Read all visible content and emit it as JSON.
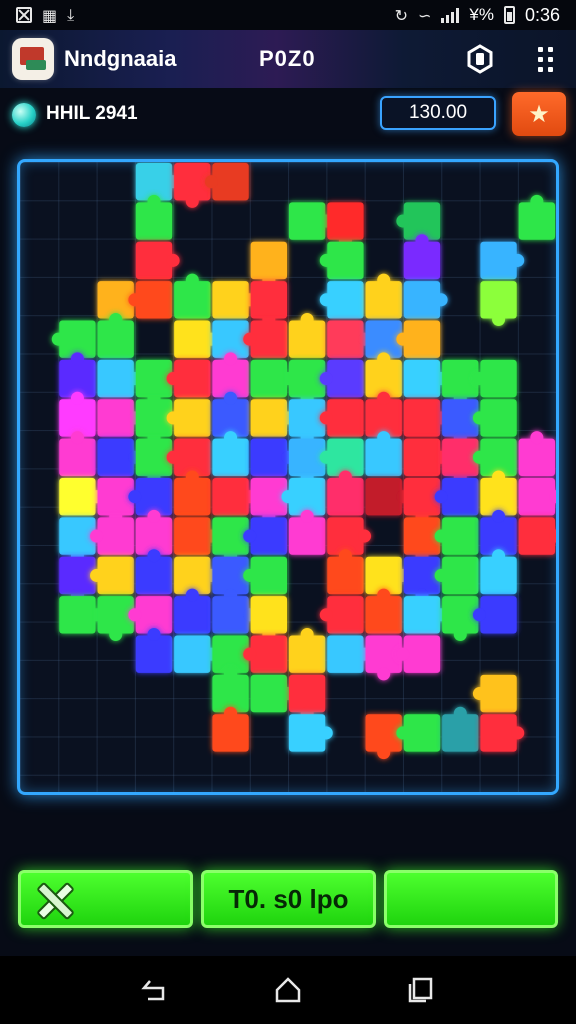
{
  "status_bar": {
    "time": "0:36",
    "percent_text": "¥%",
    "icons": [
      "close-box-icon",
      "image-icon",
      "download-icon",
      "sync-icon",
      "wifi-icon",
      "signal-icon",
      "battery-icon"
    ]
  },
  "header": {
    "title": "Nndgnaaia",
    "subtitle": "P0Z0",
    "icons": [
      "app-icon",
      "hexagon-icon",
      "grid-menu-icon"
    ]
  },
  "info": {
    "level_label": "HHIL 2941",
    "score": "130.00",
    "star": "★"
  },
  "board": {
    "cols": 14,
    "rows": 16,
    "tiles": [
      {
        "c": 3,
        "r": 0,
        "color": "#39d0e8"
      },
      {
        "c": 4,
        "r": 0,
        "color": "#ff2e3c"
      },
      {
        "c": 5,
        "r": 0,
        "color": "#e83a22"
      },
      {
        "c": 3,
        "r": 1,
        "color": "#2ee64a"
      },
      {
        "c": 7,
        "r": 1,
        "color": "#2ee64a"
      },
      {
        "c": 8,
        "r": 1,
        "color": "#ff2b2b"
      },
      {
        "c": 10,
        "r": 1,
        "color": "#22c55a"
      },
      {
        "c": 13,
        "r": 1,
        "color": "#2ee64a"
      },
      {
        "c": 3,
        "r": 2,
        "color": "#ff2e3c"
      },
      {
        "c": 6,
        "r": 2,
        "color": "#ffb21e"
      },
      {
        "c": 8,
        "r": 2,
        "color": "#2ee64a"
      },
      {
        "c": 10,
        "r": 2,
        "color": "#7a2cff"
      },
      {
        "c": 12,
        "r": 2,
        "color": "#39b4ff"
      },
      {
        "c": 2,
        "r": 3,
        "color": "#ffb21e"
      },
      {
        "c": 3,
        "r": 3,
        "color": "#ff4a1e"
      },
      {
        "c": 4,
        "r": 3,
        "color": "#2ee64a"
      },
      {
        "c": 5,
        "r": 3,
        "color": "#ffd21e"
      },
      {
        "c": 6,
        "r": 3,
        "color": "#ff2e3c"
      },
      {
        "c": 8,
        "r": 3,
        "color": "#39d0ff"
      },
      {
        "c": 9,
        "r": 3,
        "color": "#ffd21e"
      },
      {
        "c": 10,
        "r": 3,
        "color": "#39b4ff"
      },
      {
        "c": 12,
        "r": 3,
        "color": "#8cff3a"
      },
      {
        "c": 1,
        "r": 4,
        "color": "#2ee64a"
      },
      {
        "c": 2,
        "r": 4,
        "color": "#2ee64a"
      },
      {
        "c": 4,
        "r": 4,
        "color": "#ffe21e"
      },
      {
        "c": 5,
        "r": 4,
        "color": "#39c8ff"
      },
      {
        "c": 6,
        "r": 4,
        "color": "#ff2e3c"
      },
      {
        "c": 7,
        "r": 4,
        "color": "#ffd21e"
      },
      {
        "c": 8,
        "r": 4,
        "color": "#ff3a5a"
      },
      {
        "c": 9,
        "r": 4,
        "color": "#3a8cff"
      },
      {
        "c": 10,
        "r": 4,
        "color": "#ffb21e"
      },
      {
        "c": 1,
        "r": 5,
        "color": "#5a2cff"
      },
      {
        "c": 2,
        "r": 5,
        "color": "#39c8ff"
      },
      {
        "c": 3,
        "r": 5,
        "color": "#2ee64a"
      },
      {
        "c": 4,
        "r": 5,
        "color": "#ff2e3c"
      },
      {
        "c": 5,
        "r": 5,
        "color": "#ff3ad2"
      },
      {
        "c": 6,
        "r": 5,
        "color": "#2ee64a"
      },
      {
        "c": 7,
        "r": 5,
        "color": "#2ee64a"
      },
      {
        "c": 8,
        "r": 5,
        "color": "#5a3aff"
      },
      {
        "c": 9,
        "r": 5,
        "color": "#ffd21e"
      },
      {
        "c": 10,
        "r": 5,
        "color": "#39d0ff"
      },
      {
        "c": 11,
        "r": 5,
        "color": "#2ee64a"
      },
      {
        "c": 12,
        "r": 5,
        "color": "#2ee64a"
      },
      {
        "c": 1,
        "r": 6,
        "color": "#ff3aff"
      },
      {
        "c": 2,
        "r": 6,
        "color": "#ff3ad2"
      },
      {
        "c": 3,
        "r": 6,
        "color": "#2ee64a"
      },
      {
        "c": 4,
        "r": 6,
        "color": "#ffd21e"
      },
      {
        "c": 5,
        "r": 6,
        "color": "#3a5aff"
      },
      {
        "c": 6,
        "r": 6,
        "color": "#ffd21e"
      },
      {
        "c": 7,
        "r": 6,
        "color": "#39c8ff"
      },
      {
        "c": 8,
        "r": 6,
        "color": "#ff2e3c"
      },
      {
        "c": 9,
        "r": 6,
        "color": "#ff2e3c"
      },
      {
        "c": 10,
        "r": 6,
        "color": "#ff2e3c"
      },
      {
        "c": 11,
        "r": 6,
        "color": "#3a5aff"
      },
      {
        "c": 12,
        "r": 6,
        "color": "#2ee64a"
      },
      {
        "c": 1,
        "r": 7,
        "color": "#ff3ad2"
      },
      {
        "c": 2,
        "r": 7,
        "color": "#3a3aff"
      },
      {
        "c": 3,
        "r": 7,
        "color": "#2ee64a"
      },
      {
        "c": 4,
        "r": 7,
        "color": "#ff2e3c"
      },
      {
        "c": 5,
        "r": 7,
        "color": "#39d0ff"
      },
      {
        "c": 6,
        "r": 7,
        "color": "#3a3aff"
      },
      {
        "c": 7,
        "r": 7,
        "color": "#39b4ff"
      },
      {
        "c": 8,
        "r": 7,
        "color": "#2ee6a0"
      },
      {
        "c": 9,
        "r": 7,
        "color": "#39c8ff"
      },
      {
        "c": 10,
        "r": 7,
        "color": "#ff2e3c"
      },
      {
        "c": 11,
        "r": 7,
        "color": "#ff2e6a"
      },
      {
        "c": 12,
        "r": 7,
        "color": "#2ee64a"
      },
      {
        "c": 13,
        "r": 7,
        "color": "#ff3ad2"
      },
      {
        "c": 1,
        "r": 8,
        "color": "#ffff2e"
      },
      {
        "c": 2,
        "r": 8,
        "color": "#ff3ad2"
      },
      {
        "c": 3,
        "r": 8,
        "color": "#3a3aff"
      },
      {
        "c": 4,
        "r": 8,
        "color": "#ff4a1e"
      },
      {
        "c": 5,
        "r": 8,
        "color": "#ff2e3c"
      },
      {
        "c": 6,
        "r": 8,
        "color": "#ff3ad2"
      },
      {
        "c": 7,
        "r": 8,
        "color": "#39d0ff"
      },
      {
        "c": 8,
        "r": 8,
        "color": "#ff2e6a"
      },
      {
        "c": 9,
        "r": 8,
        "color": "#c21a2a"
      },
      {
        "c": 10,
        "r": 8,
        "color": "#ff2e3c"
      },
      {
        "c": 11,
        "r": 8,
        "color": "#3a3aff"
      },
      {
        "c": 12,
        "r": 8,
        "color": "#ffe21e"
      },
      {
        "c": 13,
        "r": 8,
        "color": "#ff3ad2"
      },
      {
        "c": 1,
        "r": 9,
        "color": "#39c8ff"
      },
      {
        "c": 2,
        "r": 9,
        "color": "#ff3ad2"
      },
      {
        "c": 3,
        "r": 9,
        "color": "#ff3ad2"
      },
      {
        "c": 4,
        "r": 9,
        "color": "#ff4a1e"
      },
      {
        "c": 5,
        "r": 9,
        "color": "#2ee64a"
      },
      {
        "c": 6,
        "r": 9,
        "color": "#3a3aff"
      },
      {
        "c": 7,
        "r": 9,
        "color": "#ff3ad2"
      },
      {
        "c": 8,
        "r": 9,
        "color": "#ff2e3c"
      },
      {
        "c": 10,
        "r": 9,
        "color": "#ff4a1e"
      },
      {
        "c": 11,
        "r": 9,
        "color": "#2ee64a"
      },
      {
        "c": 12,
        "r": 9,
        "color": "#3a3aff"
      },
      {
        "c": 13,
        "r": 9,
        "color": "#ff2e3c"
      },
      {
        "c": 1,
        "r": 10,
        "color": "#5a2cff"
      },
      {
        "c": 2,
        "r": 10,
        "color": "#ffd21e"
      },
      {
        "c": 3,
        "r": 10,
        "color": "#3a3aff"
      },
      {
        "c": 4,
        "r": 10,
        "color": "#ffd21e"
      },
      {
        "c": 5,
        "r": 10,
        "color": "#3a5aff"
      },
      {
        "c": 6,
        "r": 10,
        "color": "#2ee64a"
      },
      {
        "c": 8,
        "r": 10,
        "color": "#ff4a1e"
      },
      {
        "c": 9,
        "r": 10,
        "color": "#ffe21e"
      },
      {
        "c": 10,
        "r": 10,
        "color": "#3a3aff"
      },
      {
        "c": 11,
        "r": 10,
        "color": "#2ee64a"
      },
      {
        "c": 12,
        "r": 10,
        "color": "#39d0ff"
      },
      {
        "c": 1,
        "r": 11,
        "color": "#2ee64a"
      },
      {
        "c": 2,
        "r": 11,
        "color": "#2ee64a"
      },
      {
        "c": 3,
        "r": 11,
        "color": "#ff3ad2"
      },
      {
        "c": 4,
        "r": 11,
        "color": "#3a3aff"
      },
      {
        "c": 5,
        "r": 11,
        "color": "#3a5aff"
      },
      {
        "c": 6,
        "r": 11,
        "color": "#ffe21e"
      },
      {
        "c": 8,
        "r": 11,
        "color": "#ff2e3c"
      },
      {
        "c": 9,
        "r": 11,
        "color": "#ff4a1e"
      },
      {
        "c": 10,
        "r": 11,
        "color": "#39d0ff"
      },
      {
        "c": 11,
        "r": 11,
        "color": "#2ee64a"
      },
      {
        "c": 12,
        "r": 11,
        "color": "#3a3aff"
      },
      {
        "c": 3,
        "r": 12,
        "color": "#3a3aff"
      },
      {
        "c": 4,
        "r": 12,
        "color": "#39c8ff"
      },
      {
        "c": 5,
        "r": 12,
        "color": "#2ee64a"
      },
      {
        "c": 6,
        "r": 12,
        "color": "#ff2e3c"
      },
      {
        "c": 7,
        "r": 12,
        "color": "#ffd21e"
      },
      {
        "c": 8,
        "r": 12,
        "color": "#39c8ff"
      },
      {
        "c": 9,
        "r": 12,
        "color": "#ff3ad2"
      },
      {
        "c": 10,
        "r": 12,
        "color": "#ff3ad2"
      },
      {
        "c": 5,
        "r": 13,
        "color": "#2ee64a"
      },
      {
        "c": 6,
        "r": 13,
        "color": "#2ee64a"
      },
      {
        "c": 7,
        "r": 13,
        "color": "#ff2e3c"
      },
      {
        "c": 12,
        "r": 13,
        "color": "#ffc21e"
      },
      {
        "c": 5,
        "r": 14,
        "color": "#ff4a1e"
      },
      {
        "c": 7,
        "r": 14,
        "color": "#39d0ff"
      },
      {
        "c": 9,
        "r": 14,
        "color": "#ff4a1e"
      },
      {
        "c": 10,
        "r": 14,
        "color": "#2ee64a"
      },
      {
        "c": 11,
        "r": 14,
        "color": "#2aa0a8"
      },
      {
        "c": 12,
        "r": 14,
        "color": "#ff2e3c"
      }
    ]
  },
  "actions": {
    "left_icon": "tools-icon",
    "middle_label": "T0. s0 lpo",
    "right_label": ""
  },
  "nav": {
    "icons": [
      "back-icon",
      "home-icon",
      "recents-icon"
    ]
  }
}
